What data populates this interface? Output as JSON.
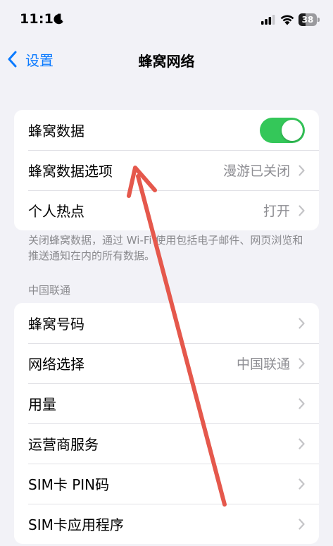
{
  "status": {
    "time": "11:14",
    "battery": "38",
    "battery_level": 0.38
  },
  "nav": {
    "back_label": "设置",
    "title": "蜂窝网络"
  },
  "cellular_group": {
    "rows": [
      {
        "label": "蜂窝数据",
        "toggle_on": true
      },
      {
        "label": "蜂窝数据选项",
        "value": "漫游已关闭"
      },
      {
        "label": "个人热点",
        "value": "打开"
      }
    ]
  },
  "footer_note": "关闭蜂窝数据，通过 Wi-Fi 使用包括电子邮件、网页浏览和推送通知在内的所有数据。",
  "carrier_section": {
    "header": "中国联通",
    "rows": [
      {
        "label": "蜂窝号码"
      },
      {
        "label": "网络选择",
        "value": "中国联通"
      },
      {
        "label": "用量"
      },
      {
        "label": "运营商服务"
      },
      {
        "label": "SIM卡 PIN码"
      },
      {
        "label": "SIM卡应用程序"
      }
    ]
  },
  "colors": {
    "accent": "#0a7aff",
    "toggle_on": "#34c759",
    "annotation_arrow": "#e5584c"
  },
  "icons": {
    "back": "chevron-left-icon",
    "disclosure": "chevron-right-icon",
    "moon": "moon-icon",
    "signal": "cellular-signal-icon",
    "wifi": "wifi-icon",
    "battery": "battery-icon"
  }
}
